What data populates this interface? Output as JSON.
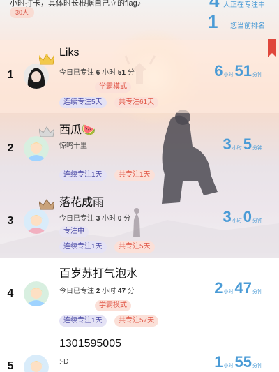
{
  "header": {
    "description": "小时打卡，具体时长根据自己立的flag♪",
    "count_badge": "30人",
    "focusing_count": "4",
    "focusing_label": "人正在专注中",
    "my_rank": "1",
    "my_rank_label": "您当前排名"
  },
  "units": {
    "hour": "小时",
    "minute": "分钟"
  },
  "rows": [
    {
      "rank": "1",
      "name": "Liks",
      "today_prefix": "今日已专注",
      "today_hours": "6",
      "today_hour_unit": "小时",
      "today_minutes": "51",
      "today_minute_unit": "分",
      "mode": "学霸模式",
      "streak": "连续专注5天",
      "total": "共专注61天",
      "time_h": "6",
      "time_m": "51",
      "crown": "gold-crown-icon"
    },
    {
      "rank": "2",
      "name": "西瓜🍉",
      "status": "惊鸣十里",
      "streak": "连续专注1天",
      "total": "共专注1天",
      "time_h": "3",
      "time_m": "5",
      "crown": "silver-crown-icon"
    },
    {
      "rank": "3",
      "name": "落花成雨",
      "today_prefix": "今日已专注",
      "today_hours": "3",
      "today_hour_unit": "小时",
      "today_minutes": "0",
      "today_minute_unit": "分",
      "mode": "专注中",
      "streak": "连续专注1天",
      "total": "共专注5天",
      "time_h": "3",
      "time_m": "0",
      "crown": "bronze-crown-icon"
    },
    {
      "rank": "4",
      "name": "百岁苏打气泡水",
      "today_prefix": "今日已专注",
      "today_hours": "2",
      "today_hour_unit": "小时",
      "today_minutes": "47",
      "today_minute_unit": "分",
      "mode": "学霸模式",
      "streak": "连续专注1天",
      "total": "共专注57天",
      "time_h": "2",
      "time_m": "47"
    },
    {
      "rank": "5",
      "name": "1301595005",
      "status": ":-D",
      "time_h": "1",
      "time_m": "55"
    }
  ],
  "colors": {
    "accent_blue": "#4a9bd6",
    "pill_red_bg": "#fbe0d8",
    "pill_red_text": "#e05545",
    "pill_purple_bg": "#e4e2f5",
    "bookmark": "#e0473c"
  }
}
